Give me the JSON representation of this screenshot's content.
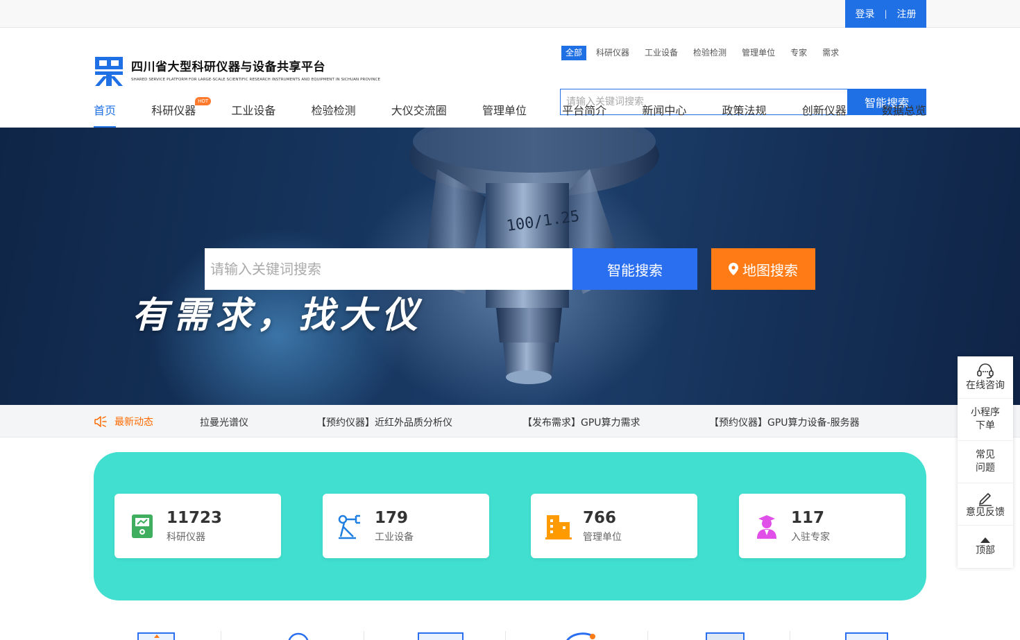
{
  "topbar": {
    "login": "登录",
    "divider": "|",
    "register": "注册"
  },
  "logo": {
    "title": "四川省大型科研仪器与设备共享平台",
    "subtitle": "SHARED SERVICE PLATFORM FOR LARGE-SCALE SCIENTIFIC RESEARCH INSTRUMENTS AND EQUIPMENT IN SICHUAN PROVINCE"
  },
  "search": {
    "tabs": [
      "全部",
      "科研仪器",
      "工业设备",
      "检验检测",
      "管理单位",
      "专家",
      "需求"
    ],
    "placeholder": "请输入关键词搜索",
    "button": "智能搜索"
  },
  "nav": {
    "items": [
      "首页",
      "科研仪器",
      "工业设备",
      "检验检测",
      "大仪交流圈",
      "管理单位",
      "平台简介",
      "新闻中心",
      "政策法规",
      "创新仪器",
      "数据总览"
    ],
    "hot_badge": "HOT"
  },
  "hero": {
    "slogan": "有需求，找大仪",
    "placeholder": "请输入关键词搜索",
    "search_button": "智能搜索",
    "map_button": "地图搜索",
    "lens_text": "100/1.25"
  },
  "ticker": {
    "label": "最新动态",
    "items": [
      "拉曼光谱仪",
      "【预约仪器】近红外品质分析仪",
      "【发布需求】GPU算力需求",
      "【预约仪器】GPU算力设备-服务器"
    ]
  },
  "stats": [
    {
      "value": "11723",
      "label": "科研仪器",
      "icon": "instrument-icon",
      "color": "#3fae5f"
    },
    {
      "value": "179",
      "label": "工业设备",
      "icon": "robot-arm-icon",
      "color": "#1f7fe0"
    },
    {
      "value": "766",
      "label": "管理单位",
      "icon": "building-icon",
      "color": "#ff9a00"
    },
    {
      "value": "117",
      "label": "入驻专家",
      "icon": "expert-icon",
      "color": "#e04fe8"
    }
  ],
  "float_bar": {
    "consult": "在线咨询",
    "miniprogram_line1": "小程序",
    "miniprogram_line2": "下单",
    "faq_line1": "常见",
    "faq_line2": "问题",
    "feedback": "意见反馈",
    "top": "顶部"
  },
  "colors": {
    "primary": "#1f6fe5",
    "orange": "#ff7b16",
    "teal": "#41dfcf"
  }
}
